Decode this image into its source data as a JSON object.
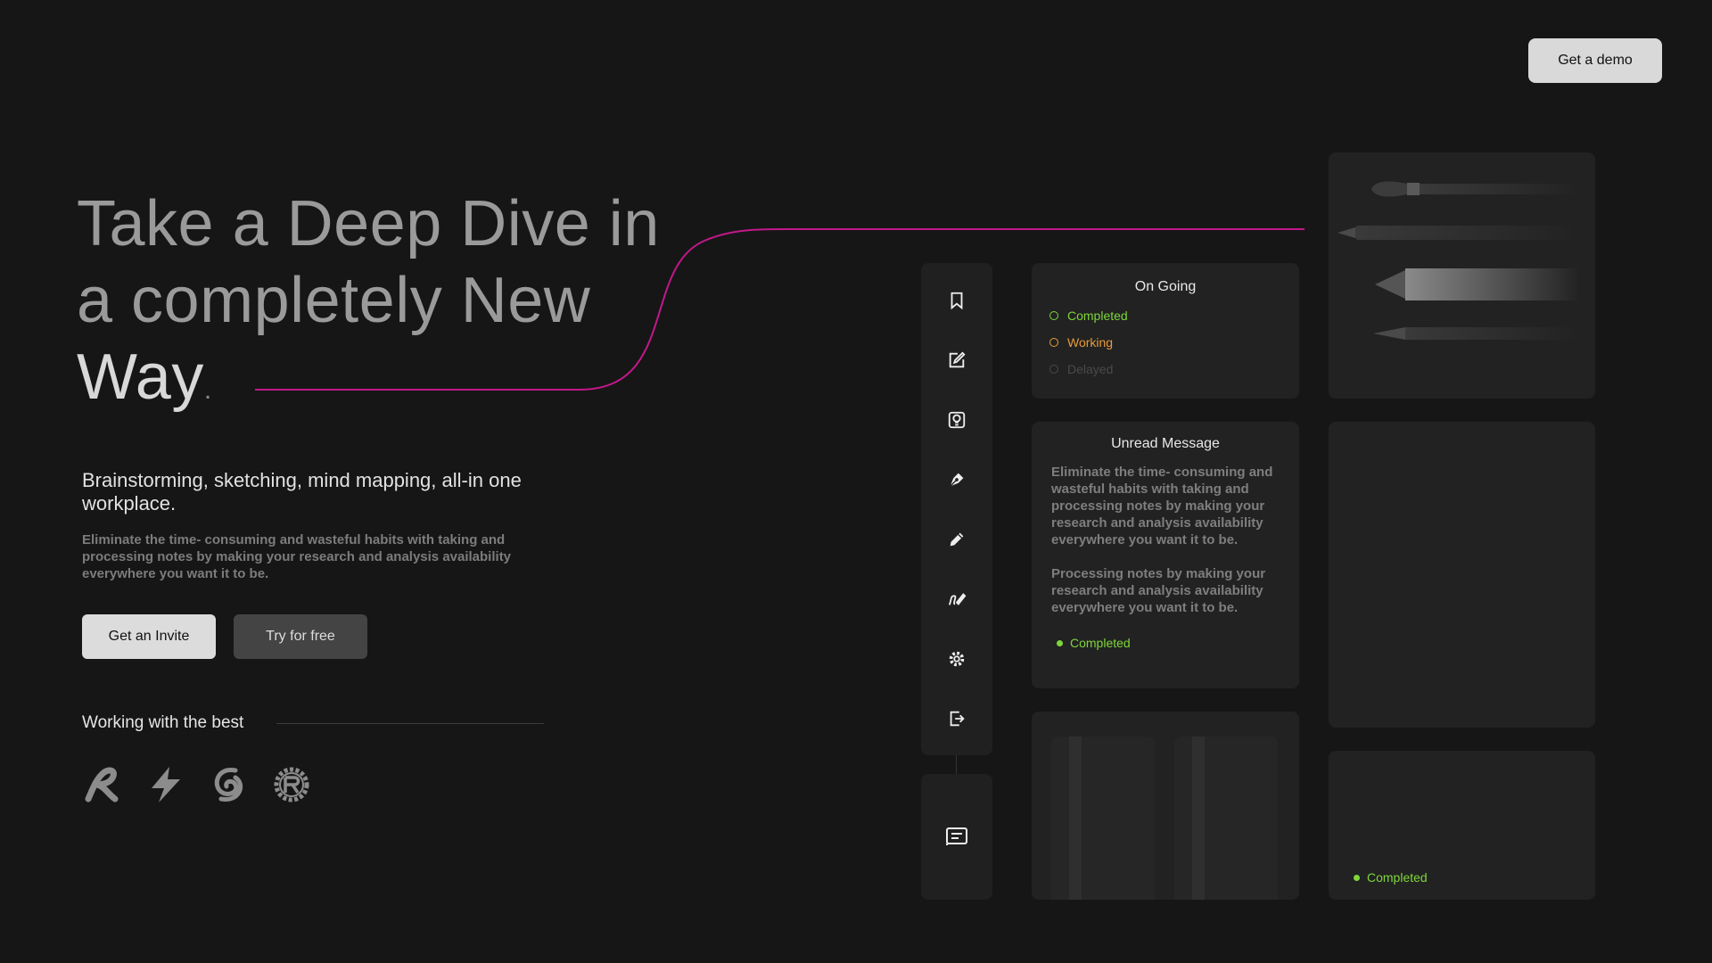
{
  "header": {
    "demo_label": "Get a demo"
  },
  "hero": {
    "title_line1": "Take a Deep Dive in",
    "title_line2": "a completely New",
    "title_line3": "Way",
    "title_dot": ".",
    "subtitle": "Brainstorming, sketching, mind mapping, all-in one workplace.",
    "description": "Eliminate the time- consuming and wasteful habits with taking and processing notes by making your research and analysis availability everywhere you want it to be.",
    "invite_label": "Get an Invite",
    "try_label": "Try for free"
  },
  "partners": {
    "heading": "Working with the best",
    "logos": [
      "r-swirl-logo",
      "bolt-logo",
      "spiral-logo",
      "rust-logo"
    ]
  },
  "sidebar": {
    "icons": [
      "bookmark-icon",
      "edit-icon",
      "lightbulb-icon",
      "pen-nib-icon",
      "pencil-icon",
      "signature-icon",
      "gear-icon",
      "logout-icon"
    ],
    "bottom_icon": "message-icon"
  },
  "ongoing": {
    "title": "On Going",
    "items": [
      {
        "label": "Completed",
        "color": "#7ed63a"
      },
      {
        "label": "Working",
        "color": "#e89b3a"
      },
      {
        "label": "Delayed",
        "color": "#4a4a4a"
      }
    ]
  },
  "unread": {
    "title": "Unread Message",
    "para1": "Eliminate the time- consuming and wasteful habits with taking and processing notes by making your research and analysis availability everywhere you want it to be.",
    "para2": "Processing notes by making your research and analysis availability everywhere you want it to be.",
    "status": "Completed",
    "status_color": "#7ed63a"
  },
  "tools_card": {
    "items": [
      "brush",
      "fineliner",
      "marker",
      "fountain-pen"
    ]
  },
  "bottom_card": {
    "status": "Completed",
    "status_color": "#7ed63a"
  },
  "colors": {
    "accent": "#c2188a",
    "background": "#161616",
    "card": "#222222"
  }
}
